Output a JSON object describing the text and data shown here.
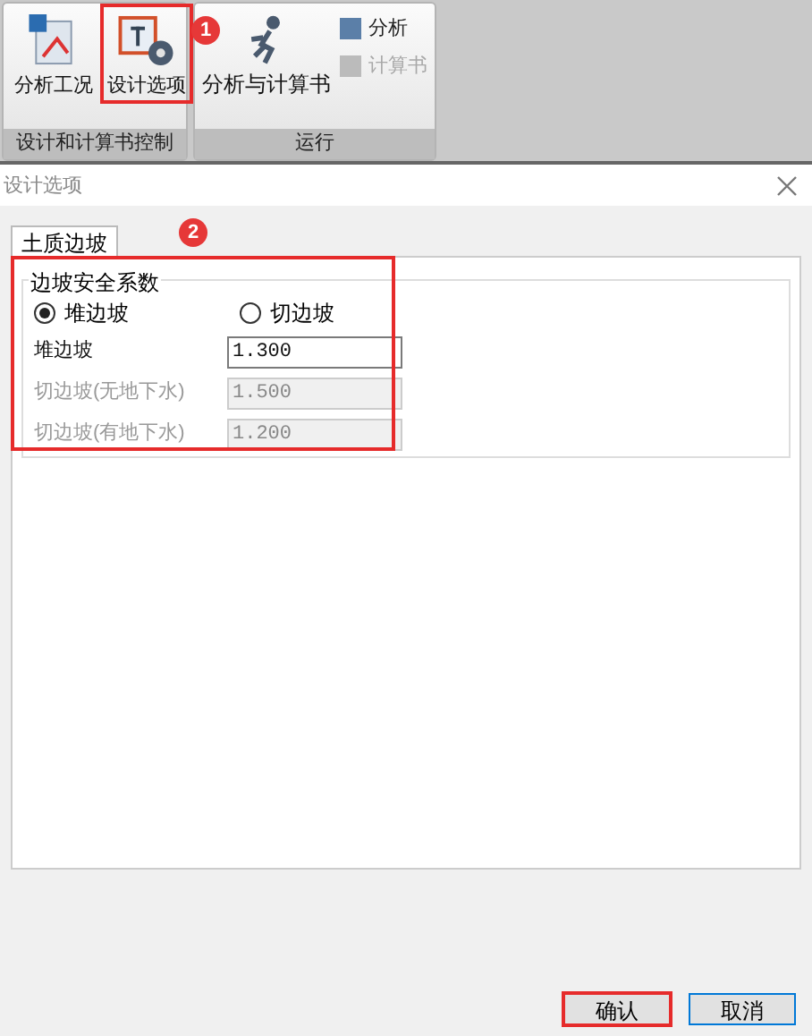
{
  "ribbon": {
    "groups": [
      {
        "label": "设计和计算书控制",
        "buttons": [
          {
            "label": "分析工况",
            "highlighted": false
          },
          {
            "label": "设计选项",
            "highlighted": true
          }
        ]
      },
      {
        "label": "运行",
        "big_button": {
          "label": "分析与计算书"
        },
        "small_buttons": [
          {
            "label": "分析",
            "disabled": false
          },
          {
            "label": "计算书",
            "disabled": true
          }
        ]
      }
    ]
  },
  "annotations": [
    "1",
    "2"
  ],
  "dialog": {
    "title": "设计选项",
    "tabs": [
      {
        "label": "土质边坡",
        "selected": true
      }
    ],
    "group": {
      "title": "边坡安全系数",
      "radios": [
        {
          "label": "堆边坡",
          "selected": true
        },
        {
          "label": "切边坡",
          "selected": false
        }
      ],
      "fields": [
        {
          "label": "堆边坡",
          "value": "1.300",
          "disabled": false
        },
        {
          "label": "切边坡(无地下水)",
          "value": "1.500",
          "disabled": true
        },
        {
          "label": "切边坡(有地下水)",
          "value": "1.200",
          "disabled": true
        }
      ]
    },
    "buttons": [
      {
        "label": "确认",
        "highlighted": true
      },
      {
        "label": "取消",
        "highlighted": false
      }
    ]
  }
}
